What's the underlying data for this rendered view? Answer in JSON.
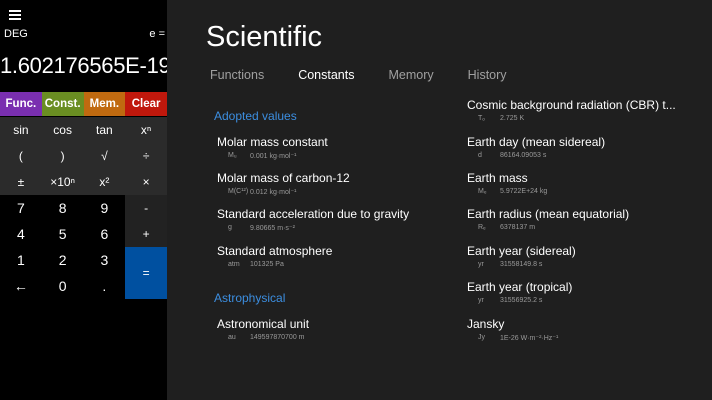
{
  "calculator": {
    "angle_mode": "DEG",
    "expression": "e =",
    "display": "1.602176565E-19",
    "mode_buttons": [
      {
        "label": "Func.",
        "color": "#7a2fb0"
      },
      {
        "label": "Const.",
        "color": "#6a8e22"
      },
      {
        "label": "Mem.",
        "color": "#c06a10"
      },
      {
        "label": "Clear",
        "color": "#c0180c"
      }
    ],
    "keys": [
      [
        "sin",
        "cos",
        "tan",
        "xⁿ"
      ],
      [
        "(",
        ")",
        "√",
        "÷"
      ],
      [
        "±",
        "×10ⁿ",
        "x²",
        "×"
      ],
      [
        "7",
        "8",
        "9",
        "-"
      ],
      [
        "4",
        "5",
        "6",
        "+"
      ],
      [
        "1",
        "2",
        "3"
      ],
      [
        "←",
        "0",
        "."
      ]
    ],
    "equals": "="
  },
  "panel": {
    "title": "Scientific",
    "tabs": [
      "Functions",
      "Constants",
      "Memory",
      "History"
    ],
    "active_tab": "Constants",
    "left_column": {
      "sections": [
        {
          "heading": "Adopted values",
          "items": [
            {
              "name": "Molar mass constant",
              "symbol": "Mᵤ",
              "value": "0.001 kg·mol⁻¹"
            },
            {
              "name": "Molar mass of carbon-12",
              "symbol": "M(C¹²)",
              "value": "0.012 kg·mol⁻¹"
            },
            {
              "name": "Standard acceleration due to gravity",
              "symbol": "g",
              "value": "9.80665 m·s⁻²"
            },
            {
              "name": "Standard atmosphere",
              "symbol": "atm",
              "value": "101325 Pa"
            }
          ]
        },
        {
          "heading": "Astrophysical",
          "items": [
            {
              "name": "Astronomical unit",
              "symbol": "au",
              "value": "149597870700 m"
            }
          ]
        }
      ]
    },
    "right_column": [
      {
        "name": "Cosmic background radiation (CBR) t...",
        "symbol": "Tₒ",
        "value": "2.725 K"
      },
      {
        "name": "Earth day (mean sidereal)",
        "symbol": "d",
        "value": "86164.09053 s"
      },
      {
        "name": "Earth mass",
        "symbol": "Mₑ",
        "value": "5.9722E+24 kg"
      },
      {
        "name": "Earth radius (mean equatorial)",
        "symbol": "Rₑ",
        "value": "6378137 m"
      },
      {
        "name": "Earth year (sidereal)",
        "symbol": "yr",
        "value": "31558149.8 s"
      },
      {
        "name": "Earth year (tropical)",
        "symbol": "yr",
        "value": "31556925.2 s"
      },
      {
        "name": "Jansky",
        "symbol": "Jy",
        "value": "1E-26 W·m⁻²·Hz⁻¹"
      }
    ]
  }
}
